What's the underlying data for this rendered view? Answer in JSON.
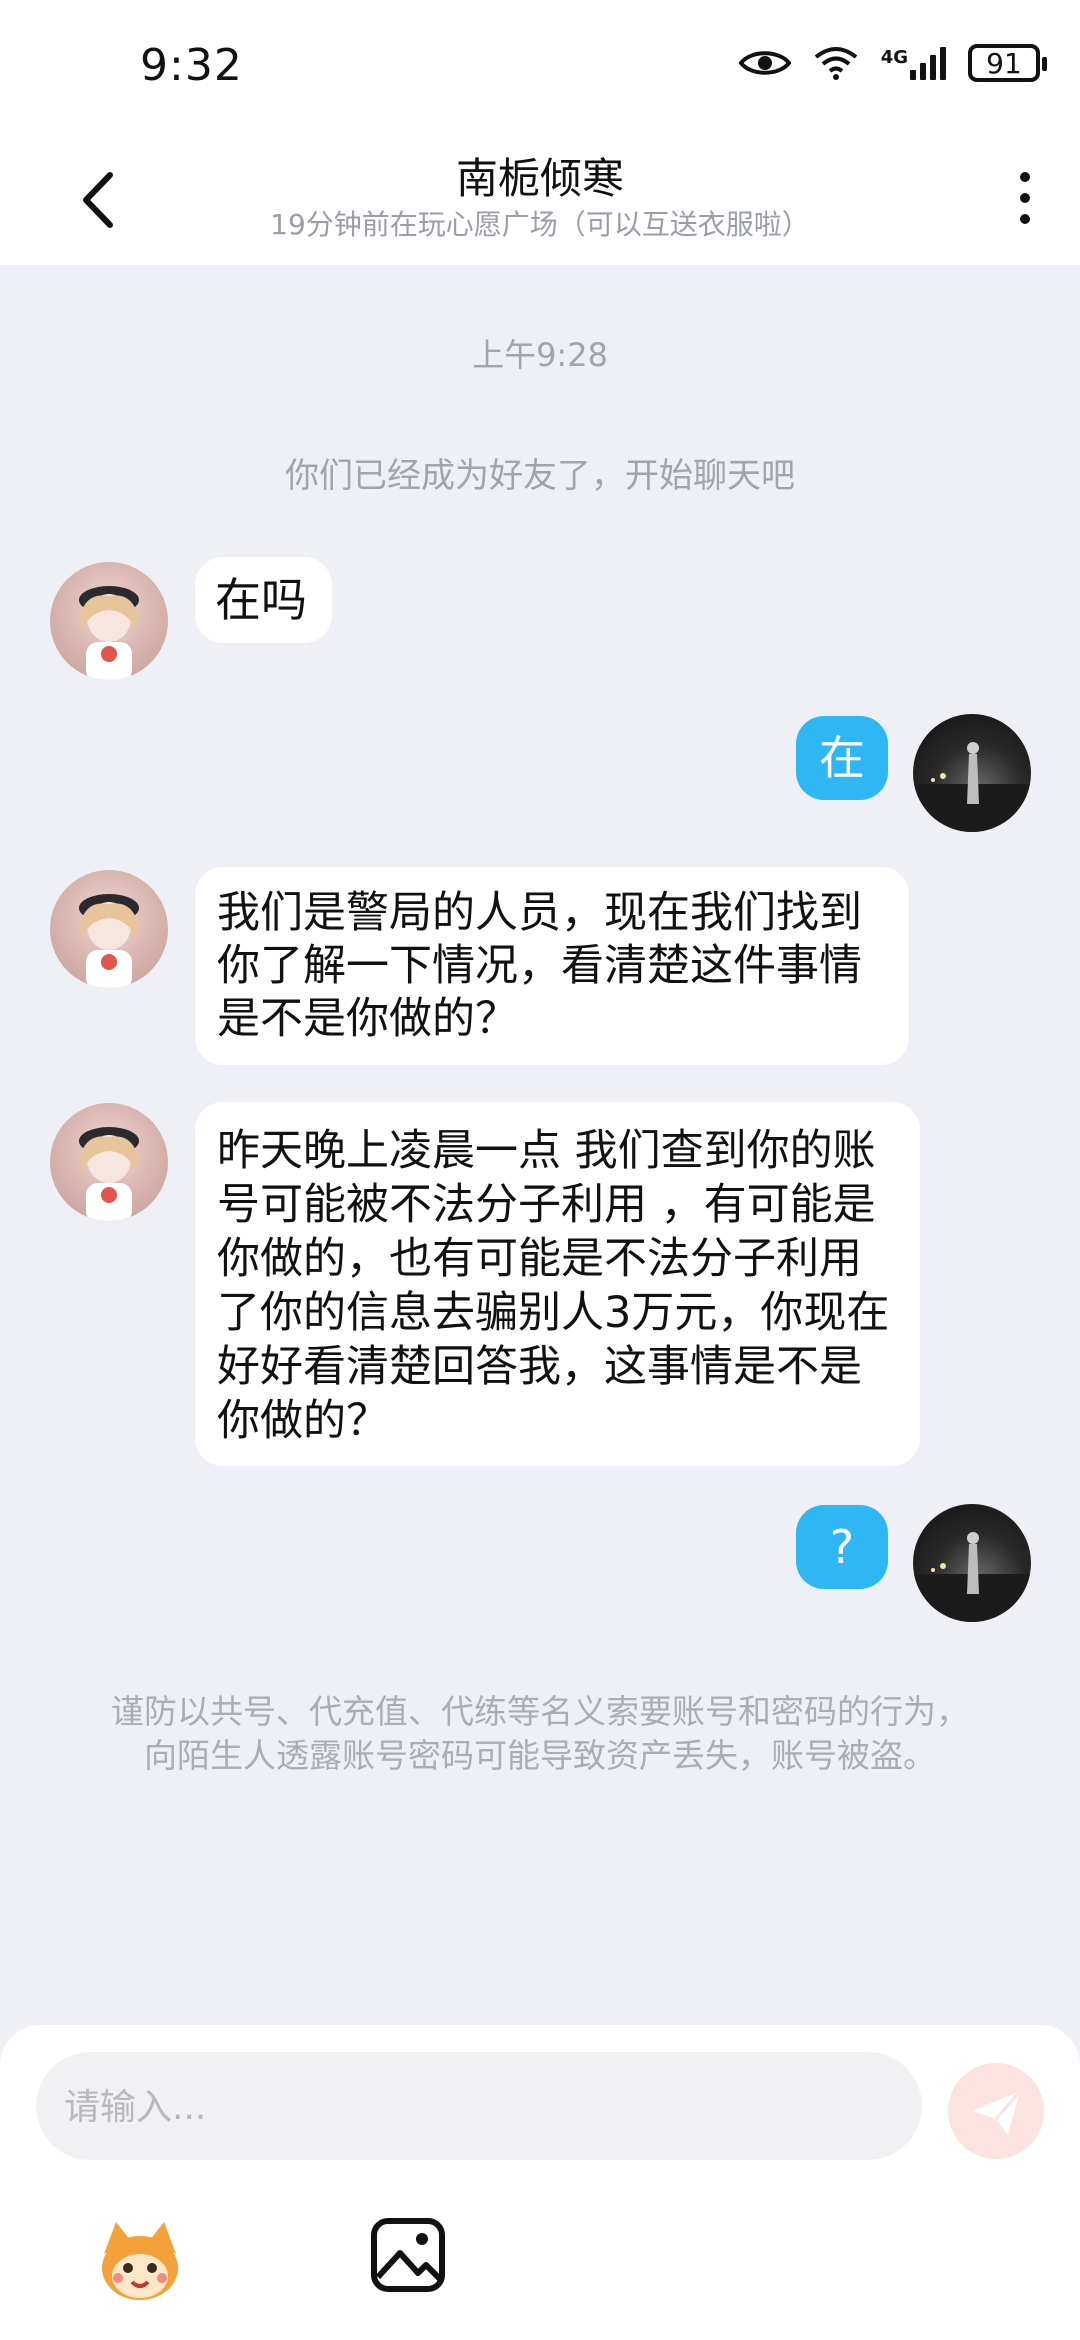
{
  "status_bar": {
    "time": "9:32",
    "network": "4G",
    "battery": "91"
  },
  "header": {
    "title": "南栀倾寒",
    "subtitle": "19分钟前在玩心愿广场（可以互送衣服啦）"
  },
  "chat": {
    "timestamp": "上午9:28",
    "system_message": "你们已经成为好友了，开始聊天吧",
    "messages": [
      {
        "side": "left",
        "text": "在吗"
      },
      {
        "side": "right",
        "text": "在"
      },
      {
        "side": "left",
        "text": "我们是警局的人员，现在我们找到你了解一下情况，看清楚这件事情是不是你做的？"
      },
      {
        "side": "left",
        "text": "昨天晚上凌晨一点 我们查到你的账号可能被不法分子利用 ，有可能是你做的，也有可能是不法分子利用了你的信息去骗别人3万元，你现在好好看清楚回答我，这事情是不是你做的？"
      },
      {
        "side": "right",
        "text": "?"
      }
    ],
    "warning": "谨防以共号、代充值、代练等名义索要账号和密码的行为，向陌生人透露账号密码可能导致资产丢失，账号被盗。"
  },
  "input": {
    "placeholder": "请输入..."
  },
  "colors": {
    "accent_blue": "#2fb7f5",
    "send_button": "#fde2e2",
    "background": "#eef0f5"
  },
  "icons": {
    "back": "chevron-left-icon",
    "more": "more-vertical-icon",
    "send": "paper-plane-icon",
    "emoji": "emoji-mascot-icon",
    "image": "image-icon"
  }
}
